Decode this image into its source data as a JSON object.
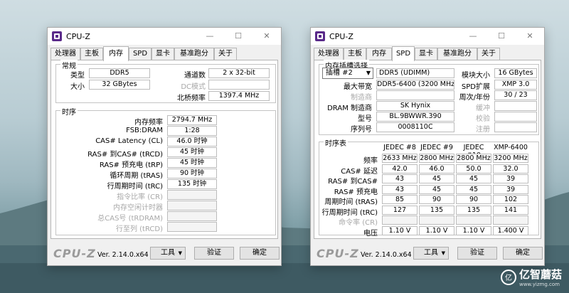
{
  "window_title": "CPU-Z",
  "tabs": [
    "处理器",
    "主板",
    "内存",
    "SPD",
    "显卡",
    "基准跑分",
    "关于"
  ],
  "win1": {
    "active_tab": "内存",
    "general": {
      "title": "常规",
      "type_label": "类型",
      "type_value": "DDR5",
      "size_label": "大小",
      "size_value": "32 GBytes",
      "channels_label": "通道数",
      "channels_value": "2 x 32-bit",
      "dc_label": "DC模式",
      "dc_value": "",
      "nb_label": "北桥频率",
      "nb_value": "1397.4 MHz"
    },
    "timings": {
      "title": "时序",
      "rows": [
        {
          "label": "内存频率",
          "value": "2794.7 MHz",
          "dim": false
        },
        {
          "label": "FSB:DRAM",
          "value": "1:28",
          "dim": false
        },
        {
          "label": "CAS# Latency (CL)",
          "value": "46.0 时钟",
          "dim": false
        },
        {
          "label": "RAS# 到CAS# (tRCD)",
          "value": "45 时钟",
          "dim": false
        },
        {
          "label": "RAS# 预充电 (tRP)",
          "value": "45 时钟",
          "dim": false
        },
        {
          "label": "循环周期 (tRAS)",
          "value": "90 时钟",
          "dim": false
        },
        {
          "label": "行周期时间 (tRC)",
          "value": "135 时钟",
          "dim": false
        },
        {
          "label": "指令比率 (CR)",
          "value": "",
          "dim": true
        },
        {
          "label": "内存空闲计时器",
          "value": "",
          "dim": true
        },
        {
          "label": "总CAS号 (tRDRAM)",
          "value": "",
          "dim": true
        },
        {
          "label": "行至列 (tRCD)",
          "value": "",
          "dim": true
        }
      ]
    }
  },
  "win2": {
    "active_tab": "SPD",
    "slot": {
      "title": "内存插槽选择",
      "slot_value": "插槽 #2",
      "module_type": "DDR5 (UDIMM)",
      "module_size_label": "模块大小",
      "module_size_value": "16 GBytes",
      "max_bw_label": "最大带宽",
      "max_bw_value": "DDR5-6400 (3200 MHz)",
      "spd_ext_label": "SPD扩展",
      "spd_ext_value": "XMP 3.0",
      "mfr_label": "制造商",
      "mfr_value": "",
      "week_year_label": "周次/年份",
      "week_year_value": "30 / 23",
      "dram_mfr_label": "DRAM 制造商",
      "dram_mfr_value": "SK Hynix",
      "buffered_label": "缓冲",
      "buffered_value": "",
      "part_label": "型号",
      "part_value": "BL.9BWWR.390",
      "check_label": "校验",
      "check_value": "",
      "serial_label": "序列号",
      "serial_value": "0008110C",
      "reg_label": "注册",
      "reg_value": ""
    },
    "timing_table": {
      "title": "时序表",
      "columns": [
        "JEDEC #8",
        "JEDEC #9",
        "JEDEC #10",
        "XMP-6400"
      ],
      "rows": [
        {
          "label": "频率",
          "values": [
            "2633 MHz",
            "2800 MHz",
            "2800 MHz",
            "3200 MHz"
          ],
          "dim": false
        },
        {
          "label": "CAS# 延迟",
          "values": [
            "42.0",
            "46.0",
            "50.0",
            "32.0"
          ],
          "dim": false
        },
        {
          "label": "RAS# 到CAS#",
          "values": [
            "43",
            "45",
            "45",
            "39"
          ],
          "dim": false
        },
        {
          "label": "RAS# 预充电",
          "values": [
            "43",
            "45",
            "45",
            "39"
          ],
          "dim": false
        },
        {
          "label": "周期时间 (tRAS)",
          "values": [
            "85",
            "90",
            "90",
            "102"
          ],
          "dim": false
        },
        {
          "label": "行周期时间 (tRC)",
          "values": [
            "127",
            "135",
            "135",
            "141"
          ],
          "dim": false
        },
        {
          "label": "命令率 (CR)",
          "values": [
            "",
            "",
            "",
            ""
          ],
          "dim": true
        },
        {
          "label": "电压",
          "values": [
            "1.10 V",
            "1.10 V",
            "1.10 V",
            "1.400 V"
          ],
          "dim": false
        }
      ]
    }
  },
  "footer": {
    "logo": "CPU-Z",
    "version": "Ver. 2.14.0.x64",
    "tools_label": "工具",
    "validate_label": "验证",
    "ok_label": "确定"
  },
  "watermark": {
    "icon": "亿",
    "text": "亿智蘑菇",
    "url": "www.yizmg.com"
  }
}
